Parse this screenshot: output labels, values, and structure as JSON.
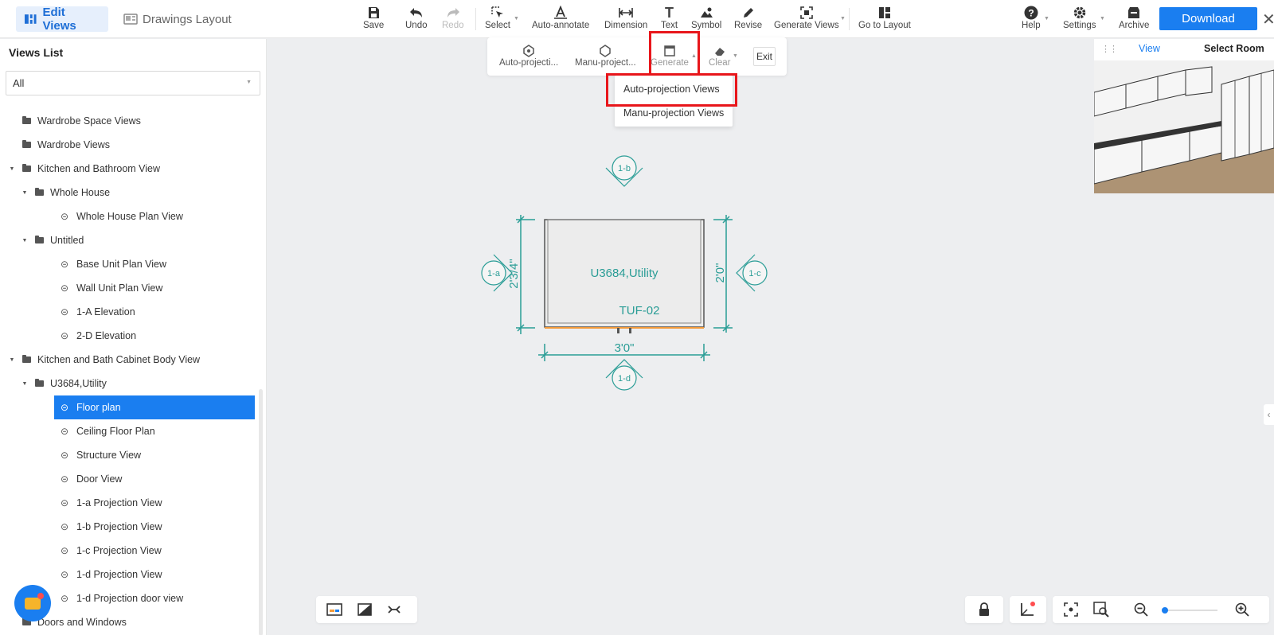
{
  "header": {
    "modes": [
      {
        "label": "Edit Views",
        "active": true
      },
      {
        "label": "Drawings Layout",
        "active": false
      }
    ],
    "tools": {
      "save": "Save",
      "undo": "Undo",
      "redo": "Redo",
      "select": "Select",
      "auto_annotate": "Auto-annotate",
      "dimension": "Dimension",
      "text": "Text",
      "symbol": "Symbol",
      "revise": "Revise",
      "generate_views": "Generate Views",
      "go_to_layout": "Go to Layout",
      "help": "Help",
      "settings": "Settings",
      "archive": "Archive"
    },
    "download_label": "Download",
    "accent_color": "#1a7ef0"
  },
  "sidebar": {
    "title": "Views List",
    "filter_value": "All",
    "tree": [
      {
        "label": "Wardrobe Space Views",
        "type": "folder",
        "level": 1,
        "expanded": null
      },
      {
        "label": "Wardrobe Views",
        "type": "folder",
        "level": 1,
        "expanded": null
      },
      {
        "label": "Kitchen and Bathroom View",
        "type": "folder",
        "level": 1,
        "expanded": true
      },
      {
        "label": "Whole House",
        "type": "folder",
        "level": 2,
        "expanded": true
      },
      {
        "label": "Whole House Plan View",
        "type": "view",
        "level": 3
      },
      {
        "label": "Untitled",
        "type": "folder",
        "level": 2,
        "expanded": true
      },
      {
        "label": "Base Unit Plan View",
        "type": "view",
        "level": 3
      },
      {
        "label": "Wall Unit Plan View",
        "type": "view",
        "level": 3
      },
      {
        "label": "1-A Elevation",
        "type": "view",
        "level": 3
      },
      {
        "label": "2-D Elevation",
        "type": "view",
        "level": 3
      },
      {
        "label": "Kitchen and Bath Cabinet Body View",
        "type": "folder",
        "level": 1,
        "expanded": true
      },
      {
        "label": "U3684,Utility",
        "type": "folder",
        "level": 2,
        "expanded": true
      },
      {
        "label": "Floor plan",
        "type": "view",
        "level": 3,
        "selected": true
      },
      {
        "label": "Ceiling Floor Plan",
        "type": "view",
        "level": 3
      },
      {
        "label": "Structure View",
        "type": "view",
        "level": 3
      },
      {
        "label": "Door View",
        "type": "view",
        "level": 3
      },
      {
        "label": "1-a Projection View",
        "type": "view",
        "level": 3
      },
      {
        "label": "1-b Projection View",
        "type": "view",
        "level": 3
      },
      {
        "label": "1-c Projection View",
        "type": "view",
        "level": 3
      },
      {
        "label": "1-d Projection View",
        "type": "view",
        "level": 3
      },
      {
        "label": "1-d Projection door view",
        "type": "view",
        "level": 3
      },
      {
        "label": "Doors and Windows",
        "type": "folder",
        "level": 1,
        "expanded": null
      }
    ]
  },
  "subtoolbar": {
    "auto_projection": "Auto-projecti...",
    "manu_projection": "Manu-project...",
    "generate": "Generate",
    "clear": "Clear",
    "exit": "Exit"
  },
  "generate_menu": {
    "items": [
      "Auto-projection Views",
      "Manu-projection Views"
    ],
    "highlight_color": "#e8161b"
  },
  "drawing": {
    "cabinet_label": "U3684,Utility",
    "door_label": "TUF-02",
    "dim_width": "3'0\"",
    "dim_left": "2'3/4\"",
    "dim_right": "2'0\"",
    "markers": [
      "1-a",
      "1-b",
      "1-c",
      "1-d"
    ],
    "line_color": "#2a9d96"
  },
  "preview": {
    "tabs": [
      "View",
      "Select Room"
    ]
  }
}
